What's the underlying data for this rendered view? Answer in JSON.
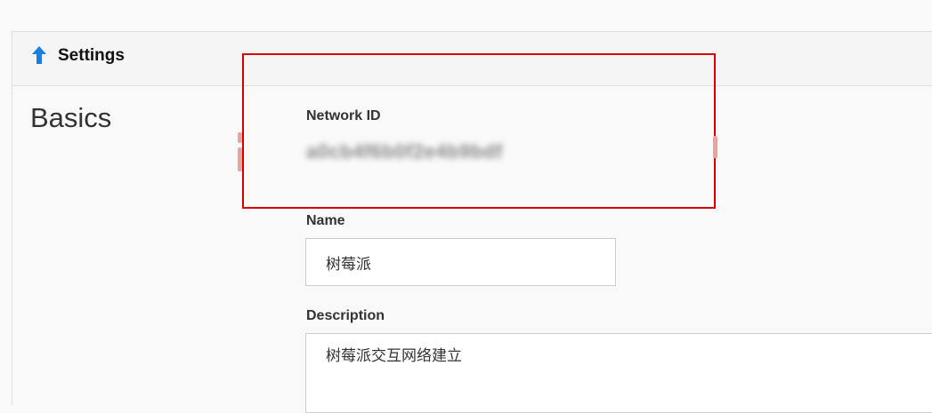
{
  "header": {
    "icon": "arrow-up-icon",
    "accent_color": "#1a7fe0",
    "title": "Settings"
  },
  "section": {
    "title": "Basics"
  },
  "network_id": {
    "label": "Network ID",
    "value": "a0cb4f6b0f2e4b9bdf"
  },
  "name_field": {
    "label": "Name",
    "value": "树莓派"
  },
  "description_field": {
    "label": "Description",
    "value": "树莓派交互网络建立"
  },
  "highlight": {
    "color": "#d40000"
  }
}
